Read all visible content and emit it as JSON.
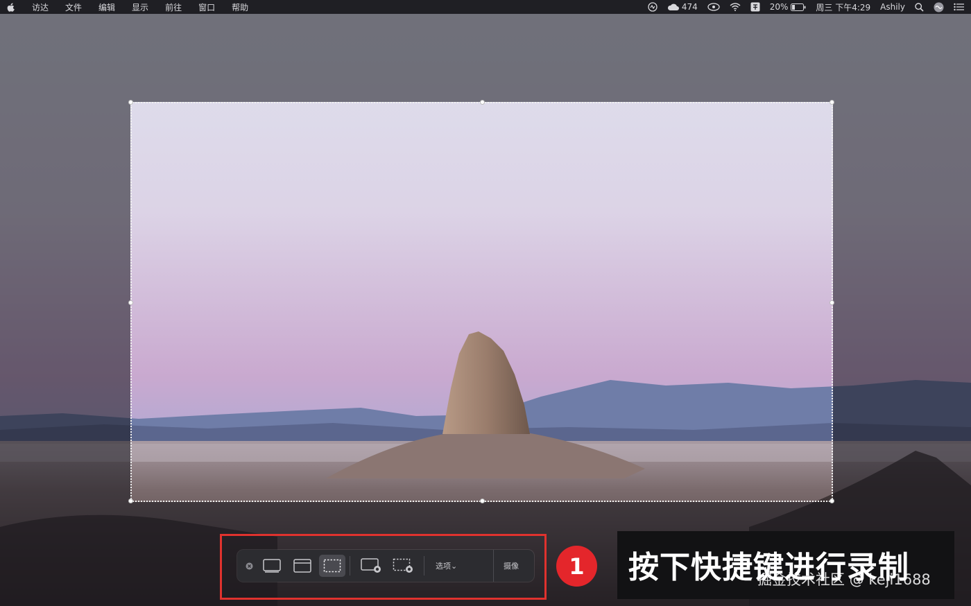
{
  "menubar": {
    "apple_icon": "apple-logo-icon",
    "items": [
      "访达",
      "文件",
      "编辑",
      "显示",
      "前往",
      "窗口",
      "帮助"
    ],
    "status": {
      "stats_value": "474",
      "battery_percent": "20%",
      "datetime": "周三 下午4:29",
      "user": "Ashily"
    }
  },
  "toolbar": {
    "options_label": "选项⌄",
    "capture_label": "摄像"
  },
  "annotation": {
    "step_number": "1",
    "caption": "按下快捷键进行录制",
    "watermark": "掘金技术社区 @ keji1688"
  },
  "colors": {
    "highlight": "#e0322e",
    "badge": "#e4262b"
  }
}
